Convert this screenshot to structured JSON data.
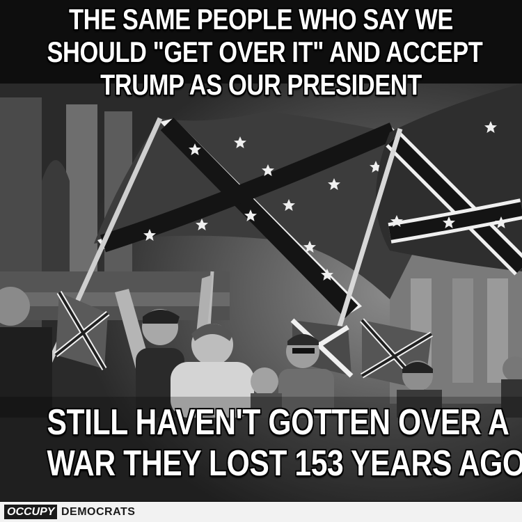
{
  "meme": {
    "top_lines": [
      "THE SAME PEOPLE WHO SAY WE",
      "SHOULD \"GET OVER IT\" AND ACCEPT",
      "TRUMP AS OUR PRESIDENT"
    ],
    "bottom_lines": [
      "STILL HAVEN'T GOTTEN OVER A",
      "WAR THEY LOST 153 YEARS AGO"
    ]
  },
  "brand": {
    "occupy": "OCCUPY",
    "democrats": "DEMOCRATS"
  },
  "colors": {
    "caption_text": "#ffffff",
    "caption_outline": "#000000",
    "brand_bar": "#f2f2f2",
    "brand_box": "#1a1a1a"
  }
}
